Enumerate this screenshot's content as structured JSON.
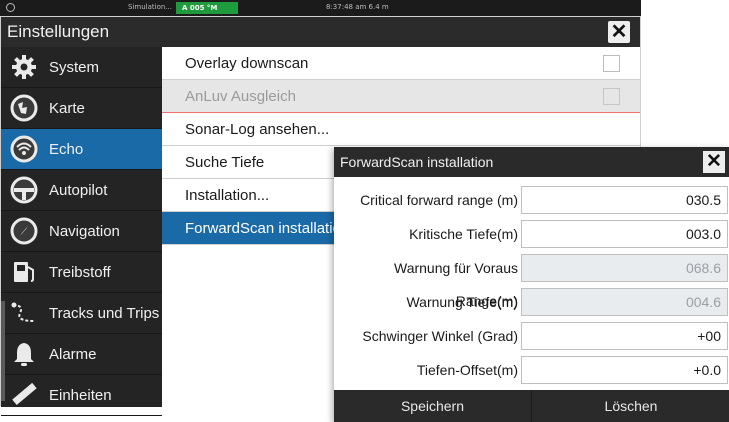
{
  "statusbar": {
    "simulation_label": "Simulation...",
    "badge_text": "A 005 °M",
    "time_text": "8:37:48 am  6.4 m"
  },
  "settings": {
    "title": "Einstellungen",
    "close_glyph": "✕",
    "sidebar": [
      {
        "label": "System",
        "icon": "gear-icon"
      },
      {
        "label": "Karte",
        "icon": "chart-icon"
      },
      {
        "label": "Echo",
        "icon": "echo-icon",
        "active": true
      },
      {
        "label": "Autopilot",
        "icon": "autopilot-icon"
      },
      {
        "label": "Navigation",
        "icon": "compass-icon"
      },
      {
        "label": "Treibstoff",
        "icon": "fuel-pump-icon"
      },
      {
        "label": "Tracks und Trips",
        "icon": "track-icon"
      },
      {
        "label": "Alarme",
        "icon": "bell-icon"
      },
      {
        "label": "Einheiten",
        "icon": "ruler-icon"
      }
    ],
    "menu": [
      {
        "label": "Overlay downscan",
        "checkbox": true
      },
      {
        "label": "AnLuv Ausgleich",
        "checkbox": true,
        "disabled": true
      },
      {
        "label": "Sonar-Log ansehen..."
      },
      {
        "label": "Suche Tiefe"
      },
      {
        "label": "Installation..."
      },
      {
        "label": "ForwardScan installation...",
        "active": true
      }
    ]
  },
  "dialog": {
    "title": "ForwardScan installation",
    "close_glyph": "✕",
    "fields": [
      {
        "label": "Critical forward range (m)",
        "value": "030.5"
      },
      {
        "label": "Kritische Tiefe(m)",
        "value": "003.0"
      },
      {
        "label": "Warnung für Voraus Range(m)",
        "value": "068.6",
        "disabled": true
      },
      {
        "label": "Warnung Tiefe(m)",
        "value": "004.6",
        "disabled": true
      },
      {
        "label": "Schwinger Winkel (Grad)",
        "value": "+00"
      },
      {
        "label": "Tiefen-Offset(m)",
        "value": "+0.0"
      }
    ],
    "save_label": "Speichern",
    "delete_label": "Löschen"
  },
  "colors": {
    "accent": "#1b6aa8",
    "dark": "#242424",
    "status_green": "#1f9a3c"
  }
}
